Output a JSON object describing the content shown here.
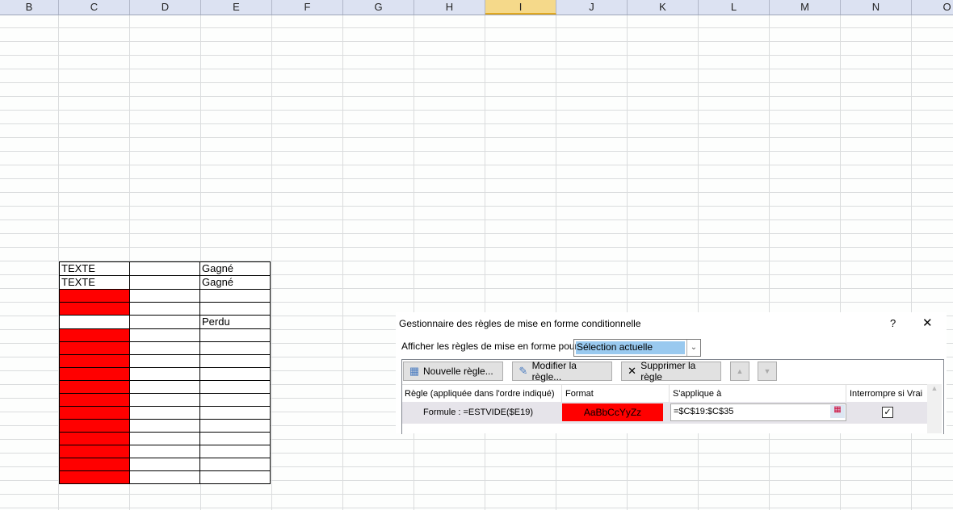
{
  "columns": [
    "B",
    "C",
    "D",
    "E",
    "F",
    "G",
    "H",
    "I",
    "J",
    "K",
    "L",
    "M",
    "N",
    "O"
  ],
  "selected_column": "I",
  "table_rows": [
    {
      "c": "TEXTE",
      "e": "Gagné",
      "red": false
    },
    {
      "c": "TEXTE",
      "e": "Gagné",
      "red": false
    },
    {
      "c": "",
      "e": "",
      "red": true
    },
    {
      "c": "",
      "e": "",
      "red": true
    },
    {
      "c": "",
      "e": "Perdu",
      "red": false
    },
    {
      "c": "",
      "e": "",
      "red": true
    },
    {
      "c": "",
      "e": "",
      "red": true
    },
    {
      "c": "",
      "e": "",
      "red": true
    },
    {
      "c": "",
      "e": "",
      "red": true
    },
    {
      "c": "",
      "e": "",
      "red": true
    },
    {
      "c": "",
      "e": "",
      "red": true
    },
    {
      "c": "",
      "e": "",
      "red": true
    },
    {
      "c": "",
      "e": "",
      "red": true
    },
    {
      "c": "",
      "e": "",
      "red": true
    },
    {
      "c": "",
      "e": "",
      "red": true
    },
    {
      "c": "",
      "e": "",
      "red": true
    },
    {
      "c": "",
      "e": "",
      "red": true
    }
  ],
  "dialog": {
    "title": "Gestionnaire des règles de mise en forme conditionnelle",
    "help": "?",
    "close": "✕",
    "show_rules_label": "Afficher les règles de mise en forme pour :",
    "show_rules_value": "Sélection actuelle",
    "new_rule": "Nouvelle règle...",
    "edit_rule": "Modifier la règle...",
    "delete_rule": "Supprimer la règle",
    "headers": {
      "rule": "Règle (appliquée dans l'ordre indiqué)",
      "format": "Format",
      "applies": "S'applique à",
      "stop": "Interrompre si Vrai"
    },
    "rule": {
      "formula": "Formule : =ESTVIDE($E19)",
      "format_preview": "AaBbCcYyZz",
      "applies_to": "=$C$19:$C$35",
      "stop_if_true": true
    },
    "format_color": "#ff0000"
  }
}
